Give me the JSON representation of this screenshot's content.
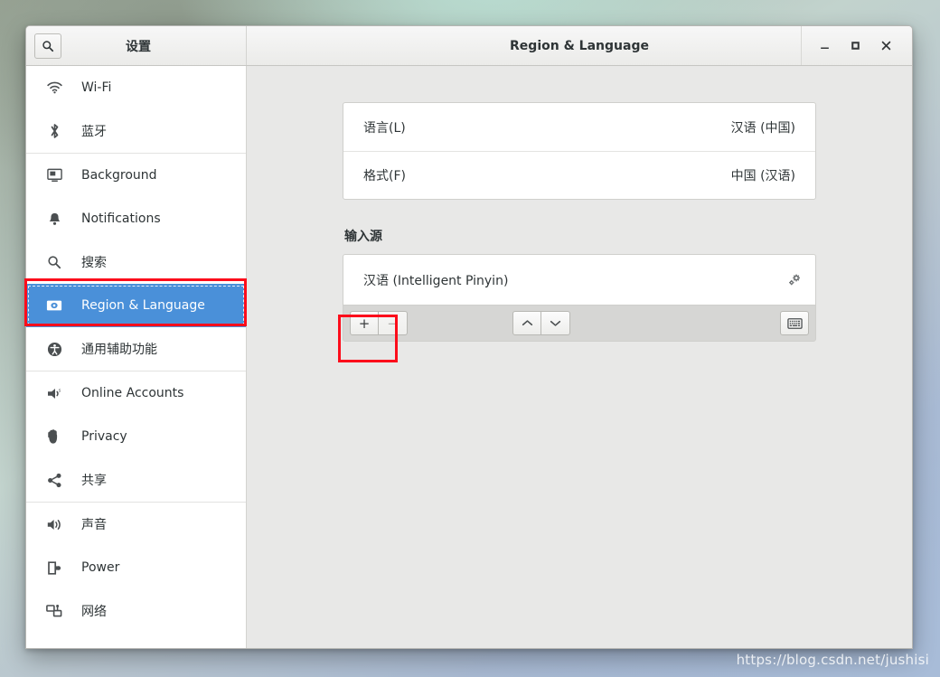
{
  "window": {
    "sidebar_title": "设置",
    "content_title": "Region & Language",
    "search_icon": "search-icon",
    "controls": {
      "minimize": "−",
      "maximize": "□",
      "close": "✕"
    }
  },
  "sidebar": {
    "groups": [
      {
        "items": [
          {
            "label": "Wi-Fi",
            "icon": "wifi-icon",
            "selected": false
          },
          {
            "label": "蓝牙",
            "icon": "bluetooth-icon",
            "selected": false
          }
        ]
      },
      {
        "items": [
          {
            "label": "Background",
            "icon": "background-icon",
            "selected": false
          },
          {
            "label": "Notifications",
            "icon": "bell-icon",
            "selected": false
          },
          {
            "label": "搜索",
            "icon": "search-icon",
            "selected": false
          },
          {
            "label": "Region & Language",
            "icon": "region-language-icon",
            "selected": true
          },
          {
            "label": "通用辅助功能",
            "icon": "accessibility-icon",
            "selected": false
          }
        ]
      },
      {
        "items": [
          {
            "label": "Online Accounts",
            "icon": "online-accounts-icon",
            "selected": false
          },
          {
            "label": "Privacy",
            "icon": "privacy-hand-icon",
            "selected": false
          },
          {
            "label": "共享",
            "icon": "sharing-icon",
            "selected": false
          }
        ]
      },
      {
        "items": [
          {
            "label": "声音",
            "icon": "sound-icon",
            "selected": false
          },
          {
            "label": "Power",
            "icon": "power-icon",
            "selected": false
          },
          {
            "label": "网络",
            "icon": "network-icon",
            "selected": false
          }
        ]
      }
    ]
  },
  "main": {
    "settings_rows": [
      {
        "label": "语言(L)",
        "value": "汉语 (中国)"
      },
      {
        "label": "格式(F)",
        "value": "中国 (汉语)"
      }
    ],
    "input_sources": {
      "title": "输入源",
      "items": [
        {
          "name": "汉语 (Intelligent Pinyin)",
          "gear_icon": "preferences-gear-icon"
        }
      ],
      "toolbar": {
        "add_label": "+",
        "remove_label": "−",
        "move_up_label": "⌃",
        "move_down_label": "⌄",
        "keyboard_icon": "keyboard-icon"
      }
    }
  },
  "annotations": {
    "color": "#fc0d1b",
    "boxes": [
      {
        "name": "region-language-highlight"
      },
      {
        "name": "add-input-source-highlight"
      }
    ]
  },
  "watermark": "https://blog.csdn.net/jushisi"
}
